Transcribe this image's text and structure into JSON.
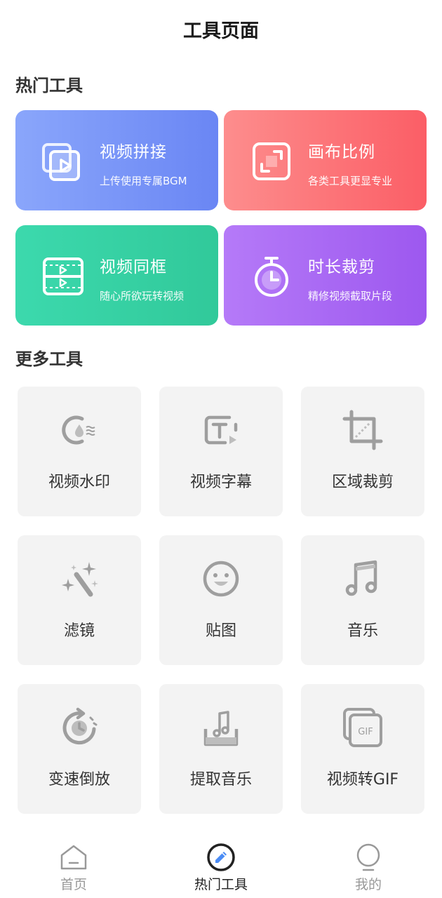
{
  "header": {
    "title": "工具页面"
  },
  "hot_section": {
    "title": "热门工具"
  },
  "hot_tools": [
    {
      "title": "视频拼接",
      "subtitle": "上传使用专属BGM",
      "icon": "video-splice-icon"
    },
    {
      "title": "画布比例",
      "subtitle": "各类工具更显专业",
      "icon": "canvas-ratio-icon"
    },
    {
      "title": "视频同框",
      "subtitle": "随心所欲玩转视频",
      "icon": "video-duet-icon"
    },
    {
      "title": "时长裁剪",
      "subtitle": "精修视频截取片段",
      "icon": "stopwatch-icon"
    }
  ],
  "more_section": {
    "title": "更多工具"
  },
  "more_tools": [
    {
      "label": "视频水印",
      "icon": "watermark-icon"
    },
    {
      "label": "视频字幕",
      "icon": "subtitle-icon"
    },
    {
      "label": "区域裁剪",
      "icon": "crop-icon"
    },
    {
      "label": "滤镜",
      "icon": "magic-wand-icon"
    },
    {
      "label": "贴图",
      "icon": "sticker-icon"
    },
    {
      "label": "音乐",
      "icon": "music-note-icon"
    },
    {
      "label": "变速倒放",
      "icon": "reverse-speed-icon"
    },
    {
      "label": "提取音乐",
      "icon": "extract-music-icon"
    },
    {
      "label": "视频转GIF",
      "icon": "gif-icon"
    }
  ],
  "tabbar": {
    "items": [
      {
        "label": "首页",
        "icon": "home-icon",
        "active": false
      },
      {
        "label": "热门工具",
        "icon": "hot-tools-icon",
        "active": true
      },
      {
        "label": "我的",
        "icon": "profile-icon",
        "active": false
      }
    ]
  },
  "colors": {
    "card_blue": "#7a96f7",
    "card_red": "#fc7078",
    "card_green": "#36d1a4",
    "card_purple": "#a967f3",
    "tool_bg": "#f3f3f3",
    "icon_gray": "#9e9e9e"
  }
}
